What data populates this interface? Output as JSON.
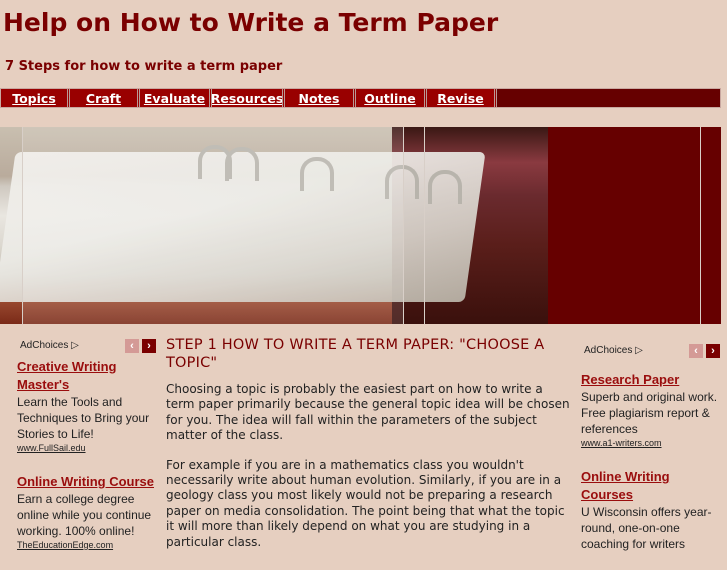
{
  "header": {
    "title": "Help on How to Write a Term Paper",
    "subtitle": "7 Steps for how to write a term paper"
  },
  "nav": {
    "items": [
      {
        "label": "Topics"
      },
      {
        "label": "Craft"
      },
      {
        "label": "Evaluate"
      },
      {
        "label": "Resources"
      },
      {
        "label": "Notes"
      },
      {
        "label": "Outline"
      },
      {
        "label": "Revise"
      }
    ]
  },
  "banner": {
    "image_description": "Thick ring binder full of paper pages on a desk"
  },
  "colors": {
    "background": "#e6cfc0",
    "brand": "#7a0000",
    "nav_item": "#990000",
    "nav_bar": "#660000",
    "ad_link": "#9a0d0d"
  },
  "ads_left": {
    "adchoices_label": "AdChoices",
    "prev_icon": "‹",
    "next_icon": "›",
    "ads": [
      {
        "title": "Creative Writing Master's",
        "description": "Learn the Tools and Techniques to Bring your Stories to Life!",
        "url": "www.FullSail.edu"
      },
      {
        "title": "Online Writing Course",
        "description": "Earn a college degree online while you continue working. 100% online!",
        "url": "TheEducationEdge.com"
      }
    ]
  },
  "ads_right": {
    "adchoices_label": "AdChoices",
    "prev_icon": "‹",
    "next_icon": "›",
    "ads": [
      {
        "title": "Research Paper",
        "description": "Superb and original work. Free plagiarism report & references",
        "url": "www.a1-writers.com"
      },
      {
        "title": "Online Writing Courses",
        "description": "U Wisconsin offers year-round, one-on-one coaching for writers",
        "url": ""
      }
    ]
  },
  "main": {
    "heading": "STEP 1 HOW TO WRITE A TERM PAPER: \"CHOOSE A TOPIC\"",
    "paragraphs": [
      "Choosing a topic is probably the easiest part on how to write a term paper primarily because the general topic idea will be chosen for you. The idea will fall within the parameters of the subject matter of the class.",
      "For example if you are in a mathematics class you wouldn't necessarily write about human evolution.  Similarly, if you are in a geology class you most likely would not be preparing a research paper on media consolidation.  The point being that what the topic it will more than likely depend on what you are studying in a particular class."
    ]
  }
}
